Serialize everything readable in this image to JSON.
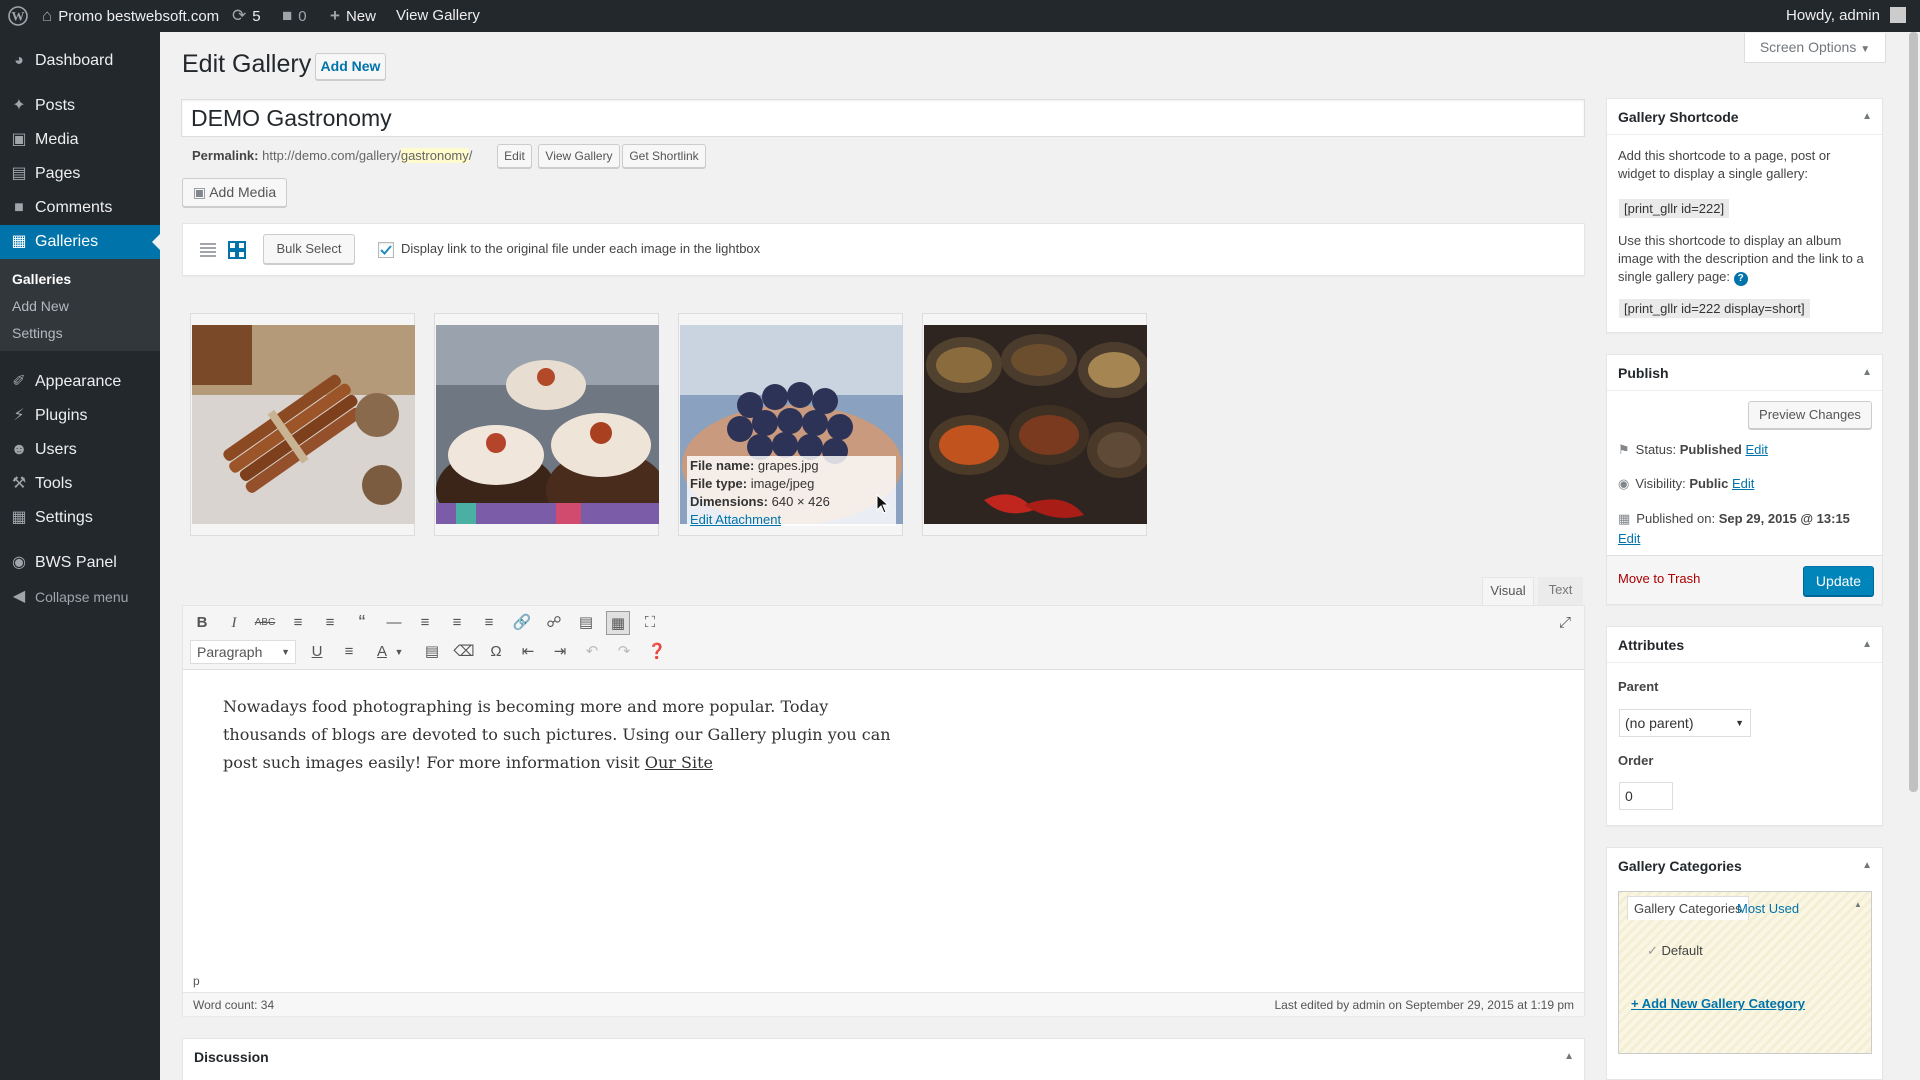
{
  "admin_bar": {
    "site_name": "Promo bestwebsoft.com",
    "updates_count": "5",
    "comments_count": "0",
    "new_label": "New",
    "view_gallery": "View Gallery",
    "howdy": "Howdy, admin"
  },
  "sidebar": {
    "items": [
      {
        "label": "Dashboard",
        "icon": "dashboard-icon"
      },
      {
        "label": "Posts",
        "icon": "pin-icon"
      },
      {
        "label": "Media",
        "icon": "media-icon"
      },
      {
        "label": "Pages",
        "icon": "pages-icon"
      },
      {
        "label": "Comments",
        "icon": "comments-icon"
      },
      {
        "label": "Galleries",
        "icon": "grid-icon"
      },
      {
        "label": "Appearance",
        "icon": "brush-icon"
      },
      {
        "label": "Plugins",
        "icon": "plugin-icon"
      },
      {
        "label": "Users",
        "icon": "users-icon"
      },
      {
        "label": "Tools",
        "icon": "wrench-icon"
      },
      {
        "label": "Settings",
        "icon": "settings-icon"
      },
      {
        "label": "BWS Panel",
        "icon": "bws-icon"
      }
    ],
    "submenu": [
      "Galleries",
      "Add New",
      "Settings"
    ],
    "collapse": "Collapse menu"
  },
  "screen_options": "Screen Options",
  "page": {
    "title": "Edit Gallery",
    "add_new": "Add New",
    "post_title": "DEMO Gastronomy",
    "permalink_label": "Permalink:",
    "permalink_base": "http://demo.com/gallery/",
    "permalink_slug": "gastronomy",
    "permalink_end": "/",
    "edit_btn": "Edit",
    "view_gallery_btn": "View Gallery",
    "shortlink_btn": "Get Shortlink",
    "add_media": "Add Media"
  },
  "gallery_toolbar": {
    "bulk_select": "Bulk Select",
    "lightbox_option": "Display link to the original file under each image in the lightbox",
    "lightbox_checked": true
  },
  "images": [
    {
      "name": "cinnamon-image"
    },
    {
      "name": "cupcakes-image"
    },
    {
      "name": "grapes-image"
    },
    {
      "name": "spices-image"
    }
  ],
  "hover_info": {
    "file_name_label": "File name:",
    "file_name": "grapes.jpg",
    "file_type_label": "File type:",
    "file_type": "image/jpeg",
    "dimensions_label": "Dimensions:",
    "dimensions": "640 × 426",
    "edit_link": "Edit Attachment"
  },
  "editor": {
    "tab_visual": "Visual",
    "tab_text": "Text",
    "format_select": "Paragraph",
    "content_part1": "Nowadays food photographing is becoming more and more popular. Today thousands of blogs are devoted to such pictures. Using our Gallery plugin you can post such images easily! For more information visit ",
    "content_link": "Our Site",
    "path": "p",
    "word_count": "Word count: 34",
    "last_edited": "Last edited by admin on September 29, 2015 at 1:19 pm"
  },
  "discussion": "Discussion",
  "shortcode_box": {
    "title": "Gallery Shortcode",
    "text1": "Add this shortcode to a page, post or widget to display a single gallery:",
    "code1": "[print_gllr id=222]",
    "text2": "Use this shortcode to display an album image with the description and the link to a single gallery page:",
    "code2": "[print_gllr id=222 display=short]"
  },
  "publish_box": {
    "title": "Publish",
    "preview": "Preview Changes",
    "status_label": "Status:",
    "status": "Published",
    "visibility_label": "Visibility:",
    "visibility": "Public",
    "published_label": "Published on:",
    "published": "Sep 29, 2015 @ 13:15",
    "edit": "Edit",
    "trash": "Move to Trash",
    "update": "Update"
  },
  "attributes_box": {
    "title": "Attributes",
    "parent_label": "Parent",
    "parent_value": "(no parent)",
    "order_label": "Order",
    "order_value": "0"
  },
  "categories_box": {
    "title": "Gallery Categories",
    "tab_all": "Gallery Categories",
    "tab_most_used": "Most Used",
    "default": "Default",
    "add_new": "+ Add New Gallery Category"
  },
  "colors": {
    "accent": "#0073aa",
    "admin_bar": "#23282d",
    "highlight": "#fffbcc",
    "danger": "#a00"
  }
}
